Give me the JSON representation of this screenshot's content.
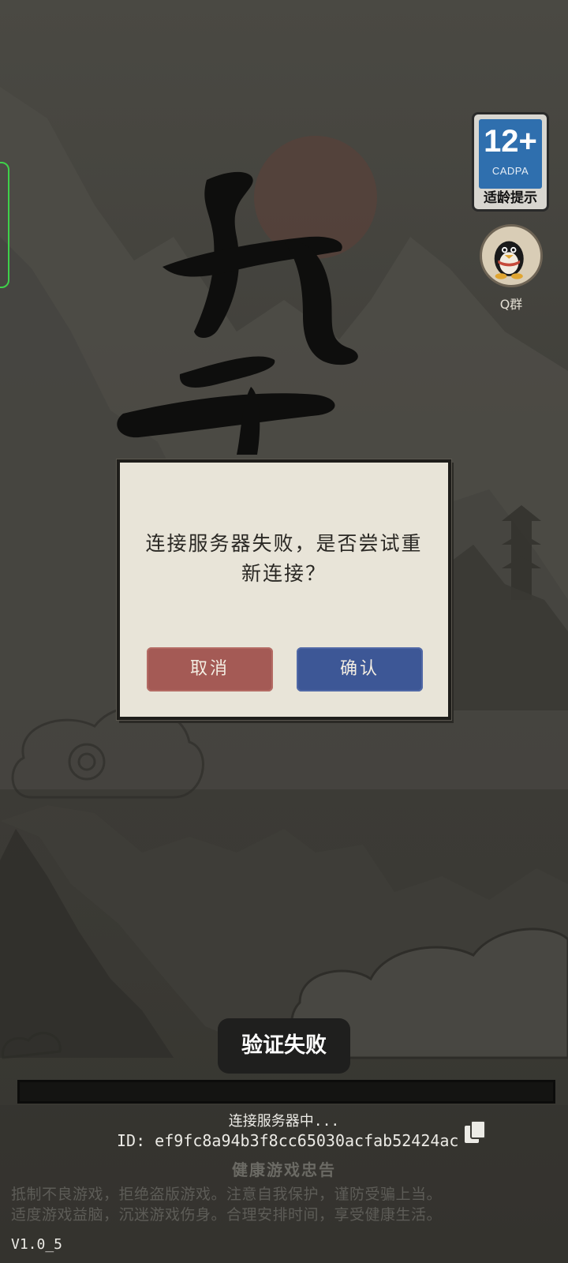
{
  "age_rating": {
    "number": "12+",
    "org": "CADPA",
    "hint": "适龄提示"
  },
  "qq_group": {
    "label": "Q群"
  },
  "dialog": {
    "message": "连接服务器失败，是否尝试重新连接？",
    "cancel_label": "取消",
    "confirm_label": "确认"
  },
  "toast": {
    "text": "验证失败"
  },
  "loading": {
    "status": "连接服务器中...",
    "id_text": "ID: ef9fc8a94b3f8cc65030acfab52424ac",
    "progress": 0
  },
  "health_notice": {
    "title": "健康游戏忠告",
    "line1": "抵制不良游戏，拒绝盗版游戏。注意自我保护，谨防受骗上当。",
    "line2": "适度游戏益脑，沉迷游戏伤身。合理安排时间，享受健康生活。"
  },
  "version": "V1.0_5",
  "colors": {
    "cancel_button": "#a45a55",
    "confirm_button": "#3d5796",
    "dialog_background": "#e8e4d8",
    "age_badge_blue": "#2f6fae"
  }
}
